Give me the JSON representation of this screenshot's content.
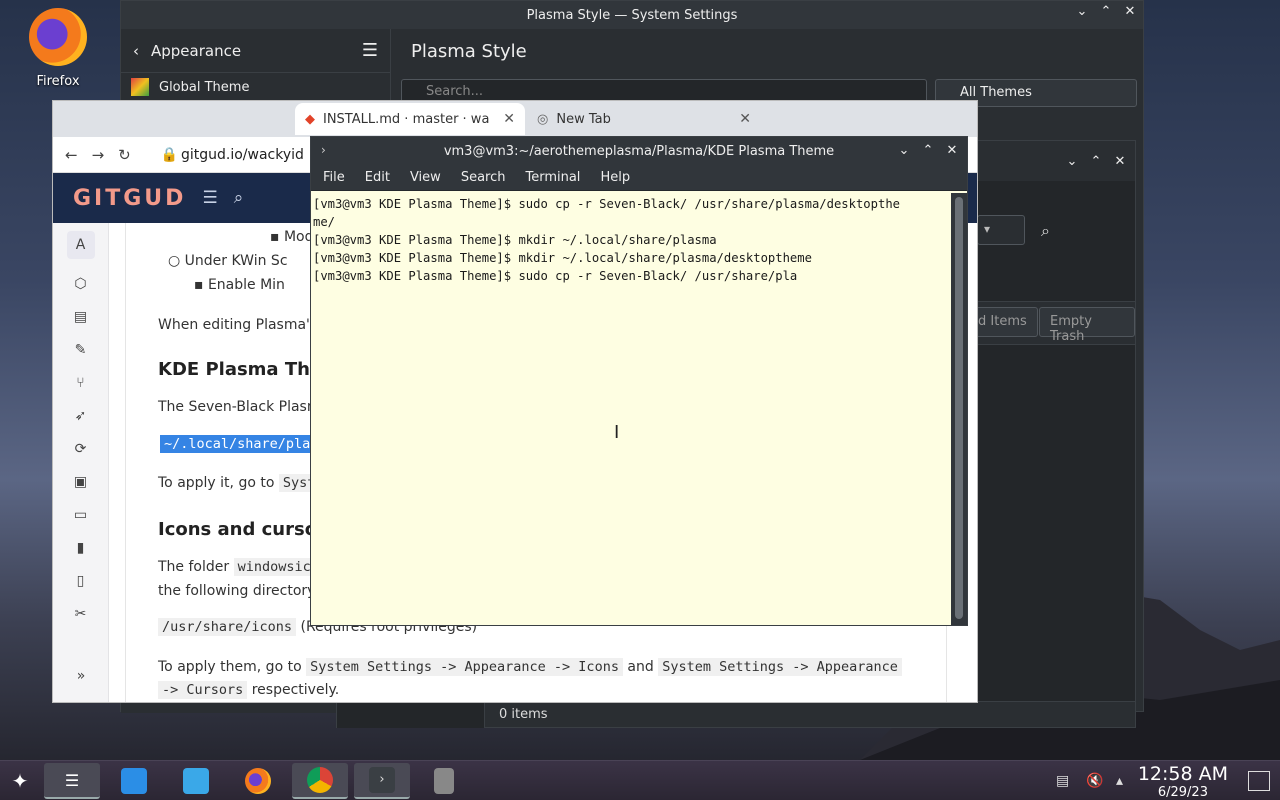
{
  "desktop": {
    "firefox_label": "Firefox"
  },
  "settings": {
    "title": "Plasma Style — System Settings",
    "back_label": "Appearance",
    "page_title": "Plasma Style",
    "sidebar_item": "Global Theme",
    "search_placeholder": "Search...",
    "filter_label": "All Themes"
  },
  "trash": {
    "restore_label": "d Items",
    "empty_label": "Empty Trash",
    "status": "0 items"
  },
  "browser": {
    "tab1": "INSTALL.md · master · wacky",
    "tab2": "New Tab",
    "url": "gitgud.io/wackyid",
    "logo": "GITGUD",
    "avatar_letter": "A",
    "doc": {
      "l1": "Modif",
      "l2": "Under KWin Sc",
      "l3": "Enable Min",
      "p1": "When editing Plasma's",
      "h1": "KDE Plasma Theme",
      "p2": "The Seven-Black Plasma",
      "c1": "~/.local/share/pla",
      "p3": "To apply it, go to",
      "c2": "Syste",
      "h2": "Icons and cursors",
      "p4a": "The folder",
      "c3": "windowsico",
      "p4b": "the following directory:",
      "c4": "/usr/share/icons",
      "p5": "(Requires root privileges)",
      "p6a": "To apply them, go to",
      "c5": "System Settings -> Appearance -> Icons",
      "p6b": "and",
      "c6": "System Settings -> Appearance",
      "c7": "-> Cursors",
      "p6c": "respectively."
    }
  },
  "terminal": {
    "title": "vm3@vm3:~/aerothemeplasma/Plasma/KDE Plasma Theme",
    "menu": [
      "File",
      "Edit",
      "View",
      "Search",
      "Terminal",
      "Help"
    ],
    "lines": [
      "[vm3@vm3 KDE Plasma Theme]$ sudo cp -r Seven-Black/ /usr/share/plasma/desktopthe",
      "me/",
      "[vm3@vm3 KDE Plasma Theme]$ mkdir ~/.local/share/plasma",
      "[vm3@vm3 KDE Plasma Theme]$ mkdir ~/.local/share/plasma/desktoptheme",
      "[vm3@vm3 KDE Plasma Theme]$ sudo cp -r Seven-Black/ /usr/share/pla"
    ]
  },
  "taskbar": {
    "time": "12:58 AM",
    "date": "6/29/23"
  }
}
